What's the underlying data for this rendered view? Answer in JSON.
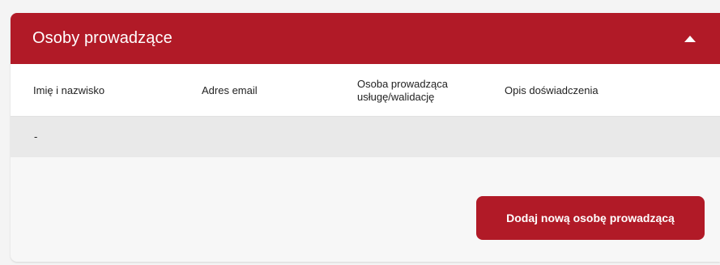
{
  "section": {
    "title": "Osoby prowadzące",
    "toggle_icon": "chevron-up-icon",
    "accent_color": "#b11a27"
  },
  "table": {
    "columns": [
      "Imię i nazwisko",
      "Adres email",
      "Osoba prowadząca usługę/walidację",
      "Opis doświadczenia"
    ],
    "rows": [
      {
        "name": "-",
        "email": "",
        "role": "",
        "description": ""
      }
    ]
  },
  "actions": {
    "add_label": "Dodaj nową osobę prowadzącą"
  }
}
